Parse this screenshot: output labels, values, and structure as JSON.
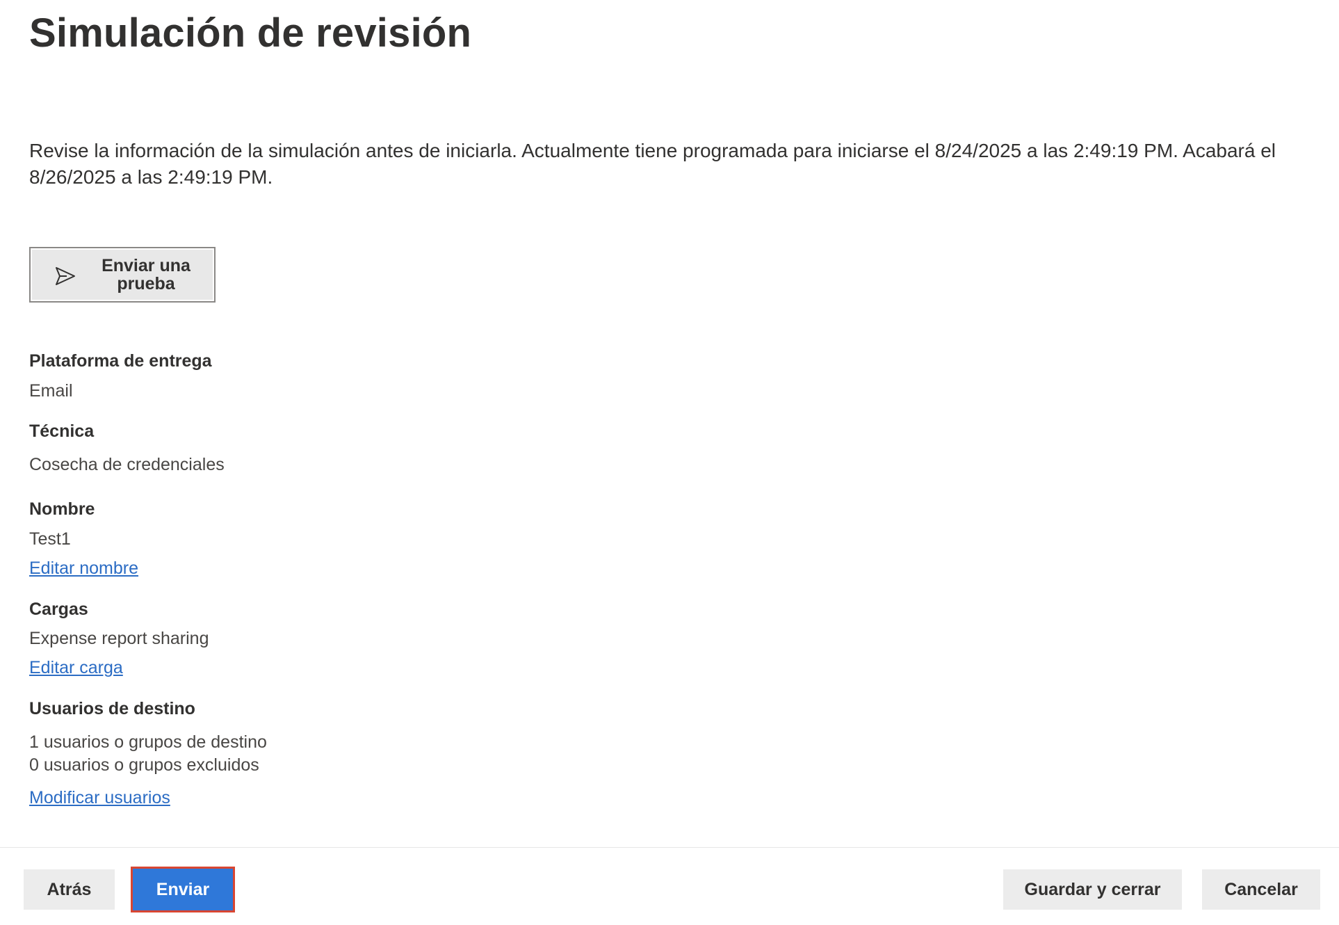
{
  "header": {
    "title": "Simulación de revisión"
  },
  "intro": {
    "text": "Revise la información de la simulación antes de iniciarla. Actualmente tiene programada para iniciarse el 8/24/2025 a las 2:49:19 PM. Acabará el 8/26/2025 a las 2:49:19 PM."
  },
  "test_button": {
    "label": "Enviar una prueba",
    "icon": "send-icon"
  },
  "details": {
    "platform": {
      "label": "Plataforma de entrega",
      "value": "Email"
    },
    "technique": {
      "label": "Técnica",
      "value": "Cosecha de credenciales"
    },
    "name": {
      "label": "Nombre",
      "value": "Test1",
      "edit_link": "Editar nombre"
    },
    "payloads": {
      "label": "Cargas",
      "value": "Expense report sharing",
      "edit_link": "Editar carga"
    },
    "target_users": {
      "label": "Usuarios de destino",
      "included": "1 usuarios o grupos de destino",
      "excluded": "0 usuarios o grupos excluidos",
      "edit_link": "Modificar usuarios"
    }
  },
  "footer": {
    "back_label": "Atrás",
    "submit_label": "Enviar",
    "save_close_label": "Guardar y cerrar",
    "cancel_label": "Cancelar"
  },
  "colors": {
    "primary": "#2f78d9",
    "highlight": "#d84632",
    "link": "#2b6cc4"
  }
}
